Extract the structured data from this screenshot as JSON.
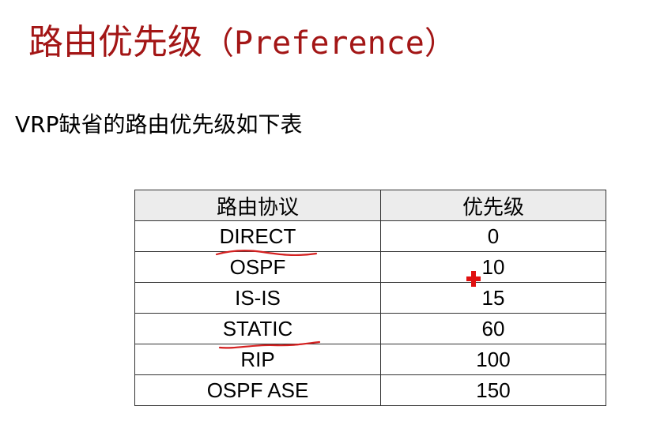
{
  "title": {
    "cn": "路由优先级",
    "en": "（Preference）"
  },
  "subtitle": "VRP缺省的路由优先级如下表",
  "table": {
    "headers": [
      "路由协议",
      "优先级"
    ],
    "rows": [
      {
        "protocol": "DIRECT",
        "preference": "0"
      },
      {
        "protocol": "OSPF",
        "preference": "10"
      },
      {
        "protocol": "IS-IS",
        "preference": "15"
      },
      {
        "protocol": "STATIC",
        "preference": "60"
      },
      {
        "protocol": "RIP",
        "preference": "100"
      },
      {
        "protocol": "OSPF ASE",
        "preference": "150"
      }
    ]
  },
  "colors": {
    "title": "#a31616",
    "annotation": "#d42020",
    "header_bg": "#ececec"
  },
  "icons": {
    "cursor": "red-cross-cursor-icon"
  }
}
